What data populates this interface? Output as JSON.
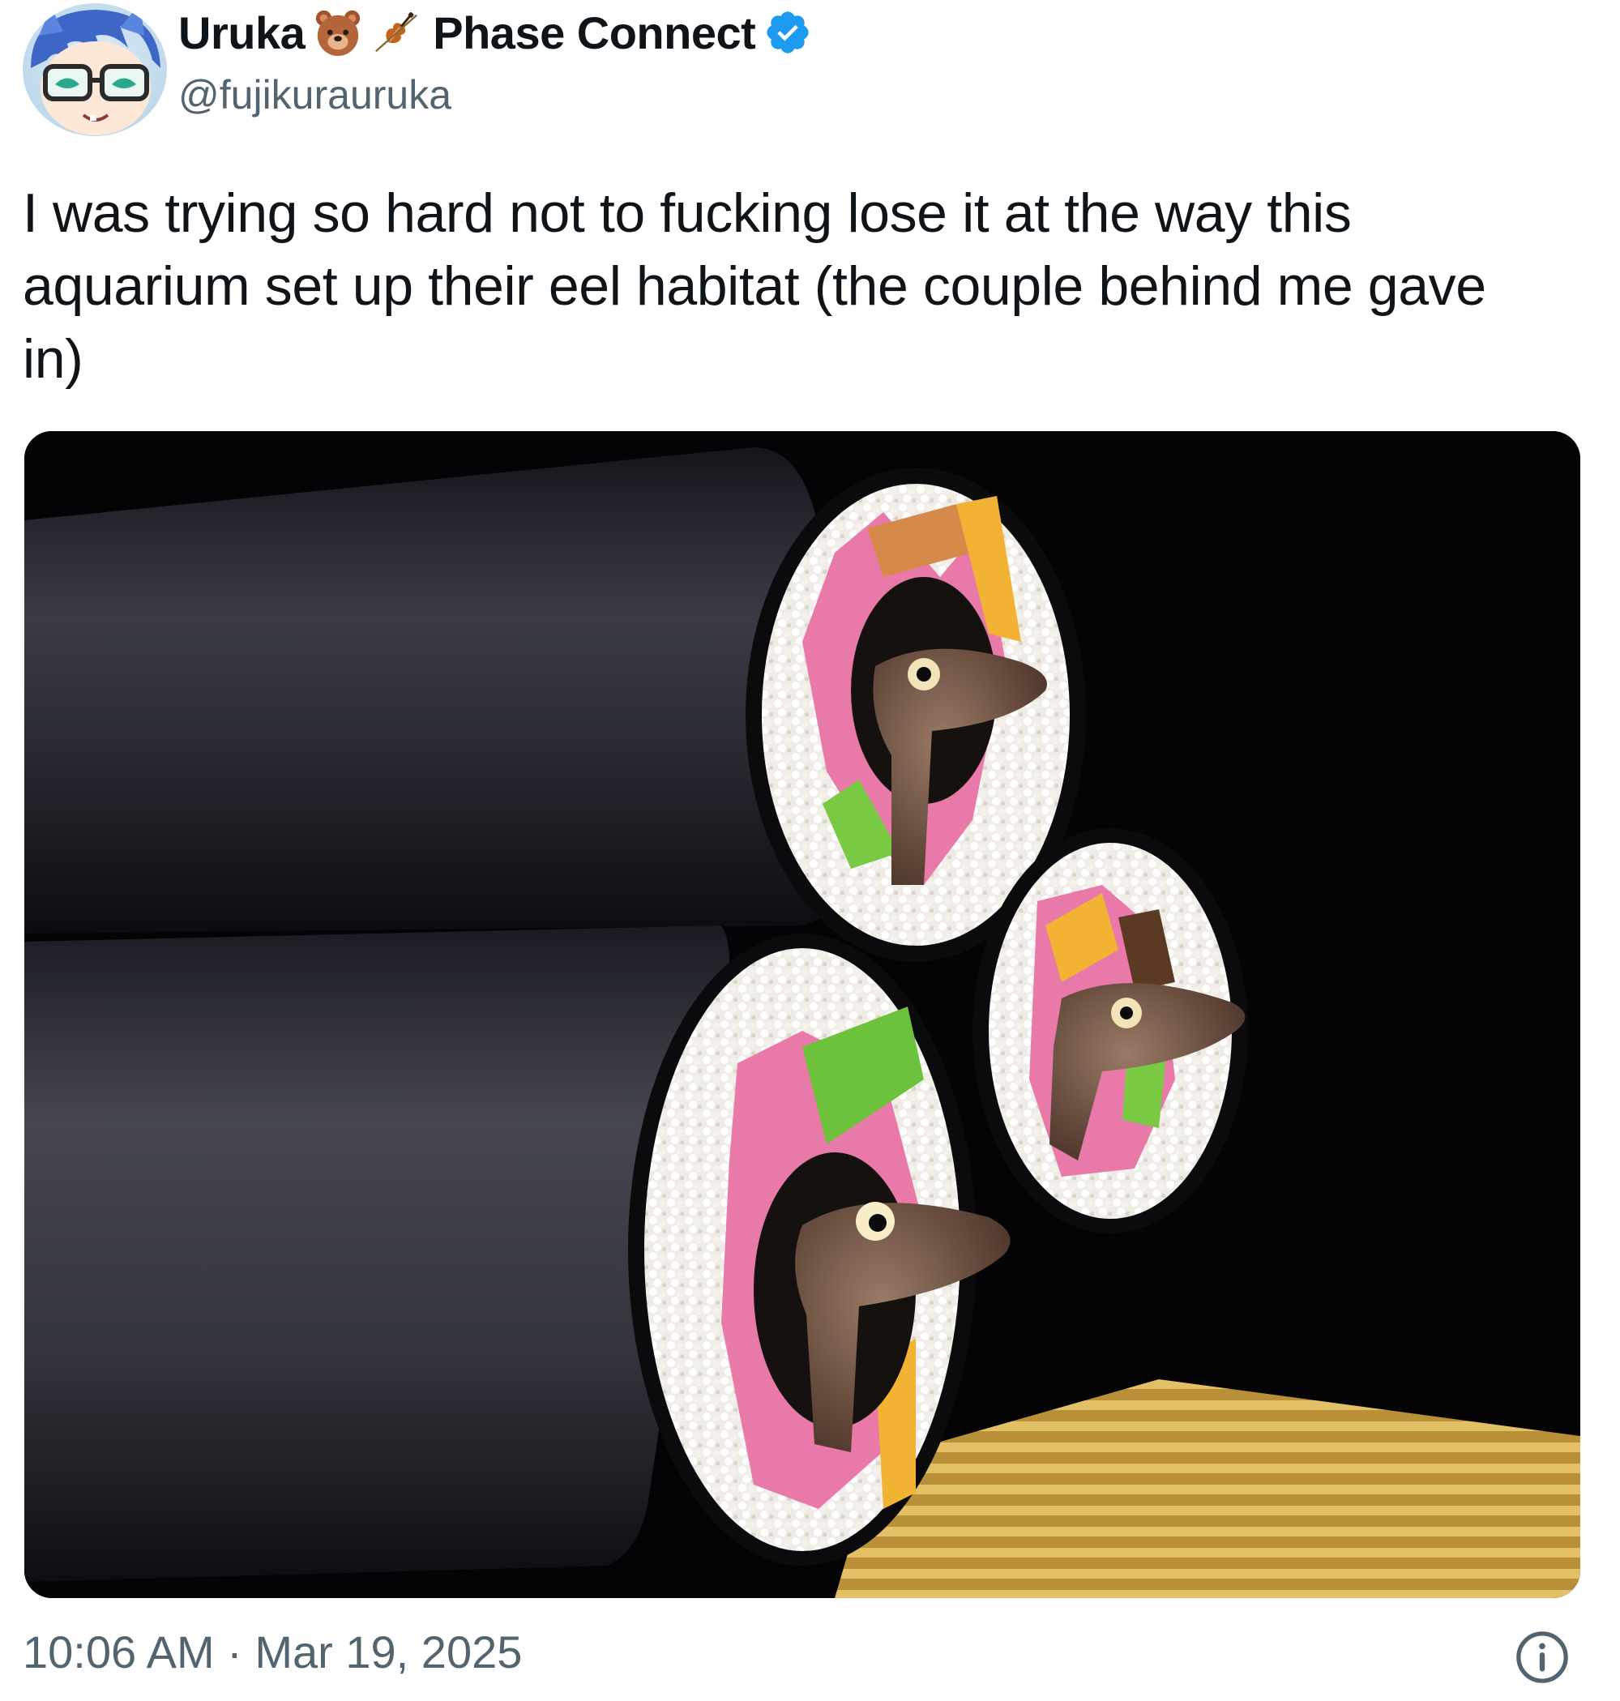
{
  "author": {
    "display_name": "Uruka",
    "emojis": [
      "bear-face-icon",
      "violin-icon"
    ],
    "name_suffix": "Phase Connect",
    "handle": "@fujikurauruka",
    "verified_icon": "verified-badge-icon",
    "verified_color": "#1d9bf0"
  },
  "tweet": {
    "text": "I was trying so hard not to fucking lose it at the way this aquarium set up their eel habitat (the couple behind me gave in)"
  },
  "footer": {
    "time": "10:06 AM",
    "separator": "·",
    "date": "Mar 19, 2025",
    "info_icon": "info-icon"
  },
  "colors": {
    "text": "#0f1419",
    "secondary": "#536471",
    "accent": "#1d9bf0"
  }
}
